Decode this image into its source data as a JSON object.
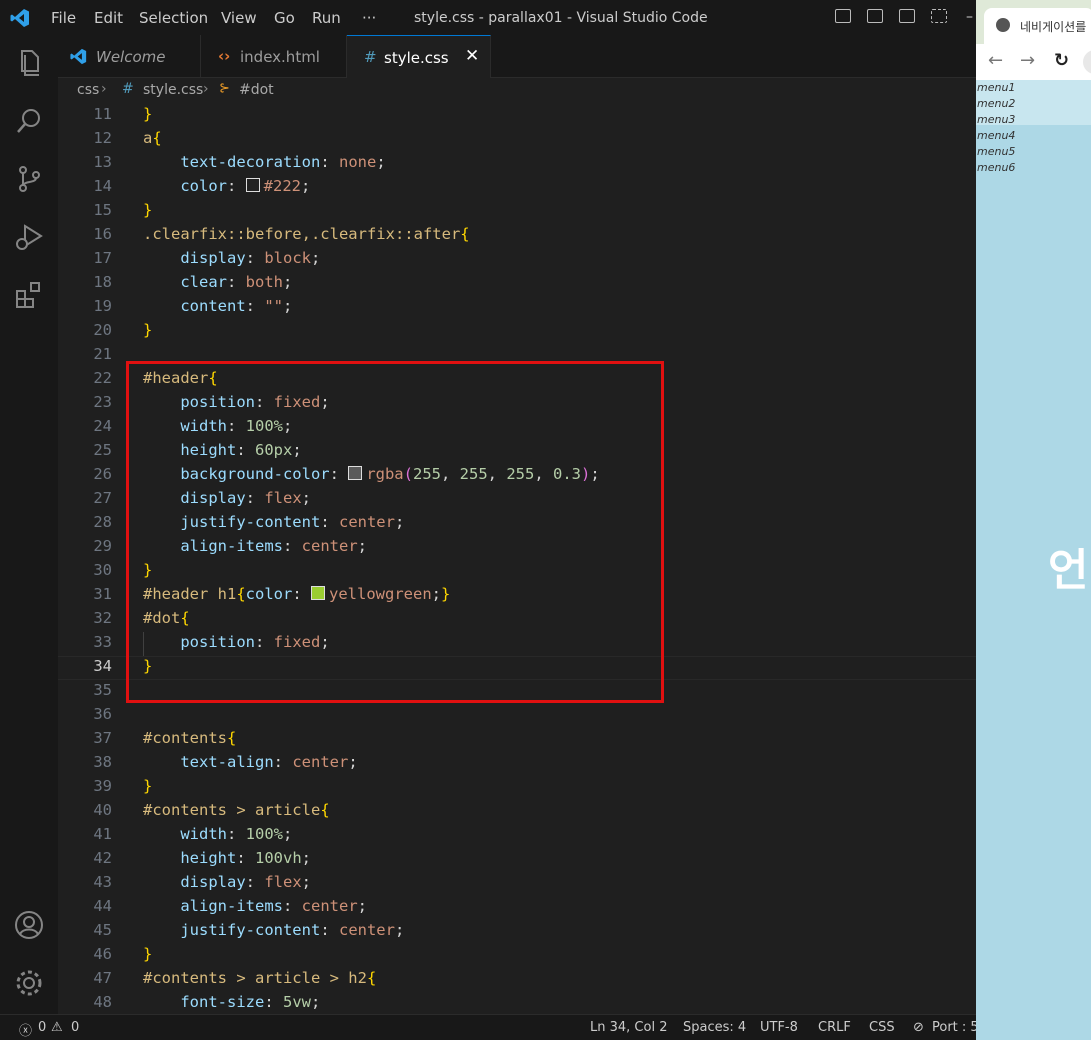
{
  "window": {
    "title": "style.css - parallax01 - Visual Studio Code",
    "menu": [
      "File",
      "Edit",
      "Selection",
      "View",
      "Go",
      "Run",
      "···"
    ]
  },
  "tabs": [
    {
      "label": "Welcome",
      "icon": "vscode-logo-icon"
    },
    {
      "label": "index.html",
      "icon": "html-icon"
    },
    {
      "label": "style.css",
      "icon": "css-hash-icon",
      "active": true
    }
  ],
  "breadcrumb": {
    "folder": "css",
    "file": "style.css",
    "symbol": "#dot"
  },
  "editor": {
    "lines": [
      {
        "n": "11",
        "html": "<span class='br'>}</span>"
      },
      {
        "n": "12",
        "html": "<span class='sel'>a</span><span class='br'>{</span>"
      },
      {
        "n": "13",
        "html": "    <span class='prop'>text-decoration</span>: <span class='val'>none</span>;"
      },
      {
        "n": "14",
        "html": "    <span class='prop'>color</span>: <span class='swatch' style='background:#222'></span><span class='val'>#222</span>;"
      },
      {
        "n": "15",
        "html": "<span class='br'>}</span>"
      },
      {
        "n": "16",
        "html": "<span class='sel'>.clearfix::before,.clearfix::after</span><span class='br'>{</span>"
      },
      {
        "n": "17",
        "html": "    <span class='prop'>display</span>: <span class='val'>block</span>;"
      },
      {
        "n": "18",
        "html": "    <span class='prop'>clear</span>: <span class='val'>both</span>;"
      },
      {
        "n": "19",
        "html": "    <span class='prop'>content</span>: <span class='val'>\"\"</span>;"
      },
      {
        "n": "20",
        "html": "<span class='br'>}</span>"
      },
      {
        "n": "21",
        "html": ""
      },
      {
        "n": "22",
        "html": "<span class='sel'>#header</span><span class='br'>{</span>"
      },
      {
        "n": "23",
        "html": "    <span class='prop'>position</span>: <span class='val'>fixed</span>;"
      },
      {
        "n": "24",
        "html": "    <span class='prop'>width</span>: <span class='num'>100%</span>;"
      },
      {
        "n": "25",
        "html": "    <span class='prop'>height</span>: <span class='num'>60px</span>;"
      },
      {
        "n": "26",
        "html": "    <span class='prop'>background-color</span>: <span class='swatch' style='background:#5a5a5a'></span><span class='val'>rgba</span><span class='br2'>(</span><span class='num'>255</span>, <span class='num'>255</span>, <span class='num'>255</span>, <span class='num'>0.3</span><span class='br2'>)</span>;"
      },
      {
        "n": "27",
        "html": "    <span class='prop'>display</span>: <span class='val'>flex</span>;"
      },
      {
        "n": "28",
        "html": "    <span class='prop'>justify-content</span>: <span class='val'>center</span>;"
      },
      {
        "n": "29",
        "html": "    <span class='prop'>align-items</span>: <span class='val'>center</span>;"
      },
      {
        "n": "30",
        "html": "<span class='br'>}</span>"
      },
      {
        "n": "31",
        "html": "<span class='sel'>#header h1</span><span class='br'>{</span><span class='prop'>color</span>: <span class='swatch' style='background:#9acd32'></span><span class='val'>yellowgreen</span>;<span class='br'>}</span>"
      },
      {
        "n": "32",
        "html": "<span class='sel'>#dot</span><span class='br'>{</span>"
      },
      {
        "n": "33",
        "html": "    <span class='prop'>position</span>: <span class='val'>fixed</span>;"
      },
      {
        "n": "34",
        "html": "<span class='br'>}</span>",
        "active": true
      },
      {
        "n": "35",
        "html": ""
      },
      {
        "n": "36",
        "html": ""
      },
      {
        "n": "37",
        "html": "<span class='sel'>#contents</span><span class='br'>{</span>"
      },
      {
        "n": "38",
        "html": "    <span class='prop'>text-align</span>: <span class='val'>center</span>;"
      },
      {
        "n": "39",
        "html": "<span class='br'>}</span>"
      },
      {
        "n": "40",
        "html": "<span class='sel'>#contents &gt; article</span><span class='br'>{</span>"
      },
      {
        "n": "41",
        "html": "    <span class='prop'>width</span>: <span class='num'>100%</span>;"
      },
      {
        "n": "42",
        "html": "    <span class='prop'>height</span>: <span class='num'>100vh</span>;"
      },
      {
        "n": "43",
        "html": "    <span class='prop'>display</span>: <span class='val'>flex</span>;"
      },
      {
        "n": "44",
        "html": "    <span class='prop'>align-items</span>: <span class='val'>center</span>;"
      },
      {
        "n": "45",
        "html": "    <span class='prop'>justify-content</span>: <span class='val'>center</span>;"
      },
      {
        "n": "46",
        "html": "<span class='br'>}</span>"
      },
      {
        "n": "47",
        "html": "<span class='sel'>#contents &gt; article &gt; h2</span><span class='br'>{</span>"
      },
      {
        "n": "48",
        "html": "    <span class='prop'>font-size</span>: <span class='num'>5vw</span>;"
      }
    ]
  },
  "status": {
    "errors": "0",
    "warnings": "0",
    "position": "Ln 34, Col 2",
    "spaces": "Spaces: 4",
    "encoding": "UTF-8",
    "eol": "CRLF",
    "language": "CSS",
    "port": "Port : 5"
  },
  "browser": {
    "tab_title": "네비게이션를",
    "menus": [
      "menu1",
      "menu2",
      "menu3",
      "menu4",
      "menu5",
      "menu6"
    ],
    "big_text": "언"
  }
}
